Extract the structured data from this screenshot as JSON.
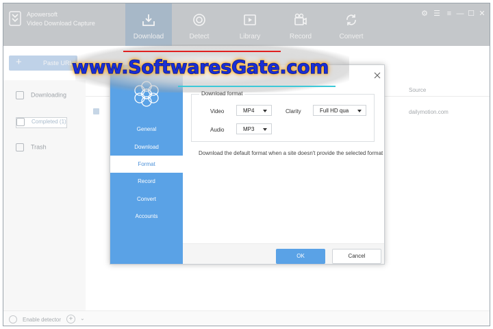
{
  "app": {
    "name_line1": "Apowersoft",
    "name_line2": "Video Download Capture"
  },
  "nav": {
    "tabs": [
      {
        "label": "Download",
        "icon": "download-icon",
        "active": true
      },
      {
        "label": "Detect",
        "icon": "detect-icon",
        "active": false
      },
      {
        "label": "Library",
        "icon": "library-icon",
        "active": false
      },
      {
        "label": "Record",
        "icon": "record-icon",
        "active": false
      },
      {
        "label": "Convert",
        "icon": "convert-icon",
        "active": false
      }
    ]
  },
  "toolbar": {
    "new_label": "Paste URL"
  },
  "sidebar": {
    "items": [
      {
        "label": "Downloading"
      },
      {
        "label": "Completed (1)"
      },
      {
        "label": "Trash"
      }
    ]
  },
  "list": {
    "source_header": "Source",
    "rows": [
      {
        "source": "dailymotion.com"
      }
    ]
  },
  "footer": {
    "scheduler_label": "Enable detector"
  },
  "dialog": {
    "nav": [
      {
        "label": "General"
      },
      {
        "label": "Download"
      },
      {
        "label": "Format"
      },
      {
        "label": "Record"
      },
      {
        "label": "Convert"
      },
      {
        "label": "Accounts"
      }
    ],
    "section_title": "Download format",
    "video_label": "Video",
    "video_value": "MP4",
    "clarity_label": "Clarity",
    "clarity_value": "Full HD qua",
    "audio_label": "Audio",
    "audio_value": "MP3",
    "hint": "Download the default format when a site doesn't provide the selected format",
    "ok_label": "OK",
    "cancel_label": "Cancel"
  },
  "watermark": {
    "text": "www.SoftwaresGate.com"
  },
  "colors": {
    "accent": "#5aa2e6",
    "topbar": "#c4c7ca",
    "watermark_text": "#1a2fd6",
    "watermark_glow": "#ff8c00"
  }
}
